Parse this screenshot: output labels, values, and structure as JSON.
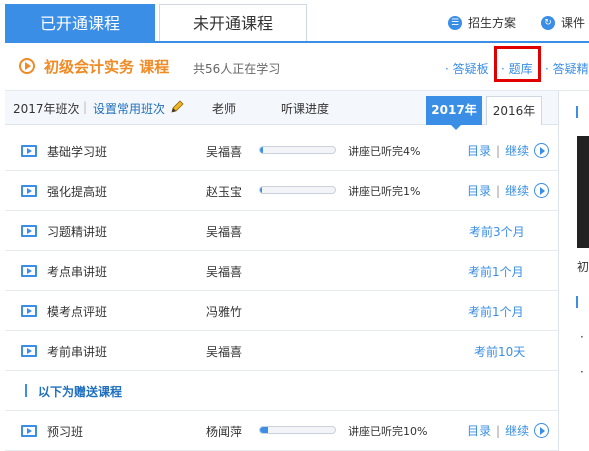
{
  "tabs": {
    "active": "已开通课程",
    "inactive": "未开通课程"
  },
  "top_links": {
    "admissions": "招生方案",
    "courseware": "课件"
  },
  "course": {
    "title": "初级会计实务  课程",
    "learners": "共56人正在学习",
    "links": [
      "· 答疑板",
      "· 题库",
      "· 答疑精"
    ]
  },
  "table_header": {
    "class_year": "2017年班次",
    "set_common": "设置常用班次",
    "teacher": "老师",
    "progress": "听课进度",
    "year_tabs": [
      "2017年",
      "2016年"
    ]
  },
  "rows": [
    {
      "name": "基础学习班",
      "teacher": "吴福喜",
      "progress_text": "讲座已听完4%",
      "progress": 4,
      "catalog": "目录",
      "continue": "继续"
    },
    {
      "name": "强化提高班",
      "teacher": "赵玉宝",
      "progress_text": "讲座已听完1%",
      "progress": 1,
      "catalog": "目录",
      "continue": "继续"
    },
    {
      "name": "习题精讲班",
      "teacher": "吴福喜",
      "note": "考前3个月"
    },
    {
      "name": "考点串讲班",
      "teacher": "吴福喜",
      "note": "考前1个月"
    },
    {
      "name": "模考点评班",
      "teacher": "冯雅竹",
      "note": "考前1个月"
    },
    {
      "name": "考前串讲班",
      "teacher": "吴福喜",
      "note": "考前10天"
    }
  ],
  "gift_heading": "以下为赠送课程",
  "gift_rows": [
    {
      "name": "预习班",
      "teacher": "杨闻萍",
      "progress_text": "讲座已听完10%",
      "progress": 10,
      "catalog": "目录",
      "continue": "继续"
    }
  ],
  "right_panel": {
    "caption": "初"
  },
  "colors": {
    "accent": "#3a8ee6",
    "orange": "#f08a24",
    "highlight": "#e00000"
  }
}
